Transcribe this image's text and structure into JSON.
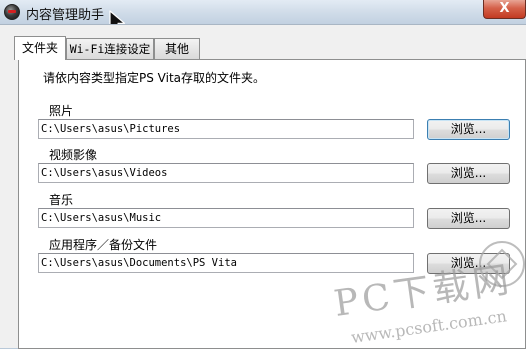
{
  "window": {
    "title": "内容管理助手",
    "close_label": "X"
  },
  "tabs": [
    {
      "label": "文件夹",
      "active": true
    },
    {
      "label": "Wi-Fi连接设定",
      "active": false
    },
    {
      "label": "其他",
      "active": false
    }
  ],
  "panel": {
    "instruction": "请依内容类型指定PS  Vita存取的文件夹。",
    "folders": [
      {
        "label": "照片",
        "path": "C:\\Users\\asus\\Pictures",
        "button": "浏览..."
      },
      {
        "label": "视频影像",
        "path": "C:\\Users\\asus\\Videos",
        "button": "浏览..."
      },
      {
        "label": "音乐",
        "path": "C:\\Users\\asus\\Music",
        "button": "浏览..."
      },
      {
        "label": "应用程序／备份文件",
        "path": "C:\\Users\\asus\\Documents\\PS Vita",
        "button": "浏览..."
      }
    ]
  },
  "watermark": {
    "brand": "PC下载网",
    "url": "www.pcsoft.com.cn"
  },
  "icons": {
    "app": "playstation-app-icon",
    "cursor": "mouse-pointer-icon"
  },
  "colors": {
    "close_button": "#c8462d",
    "title_bar": "#cfdbe8",
    "watermark": "#9a9a9a"
  }
}
